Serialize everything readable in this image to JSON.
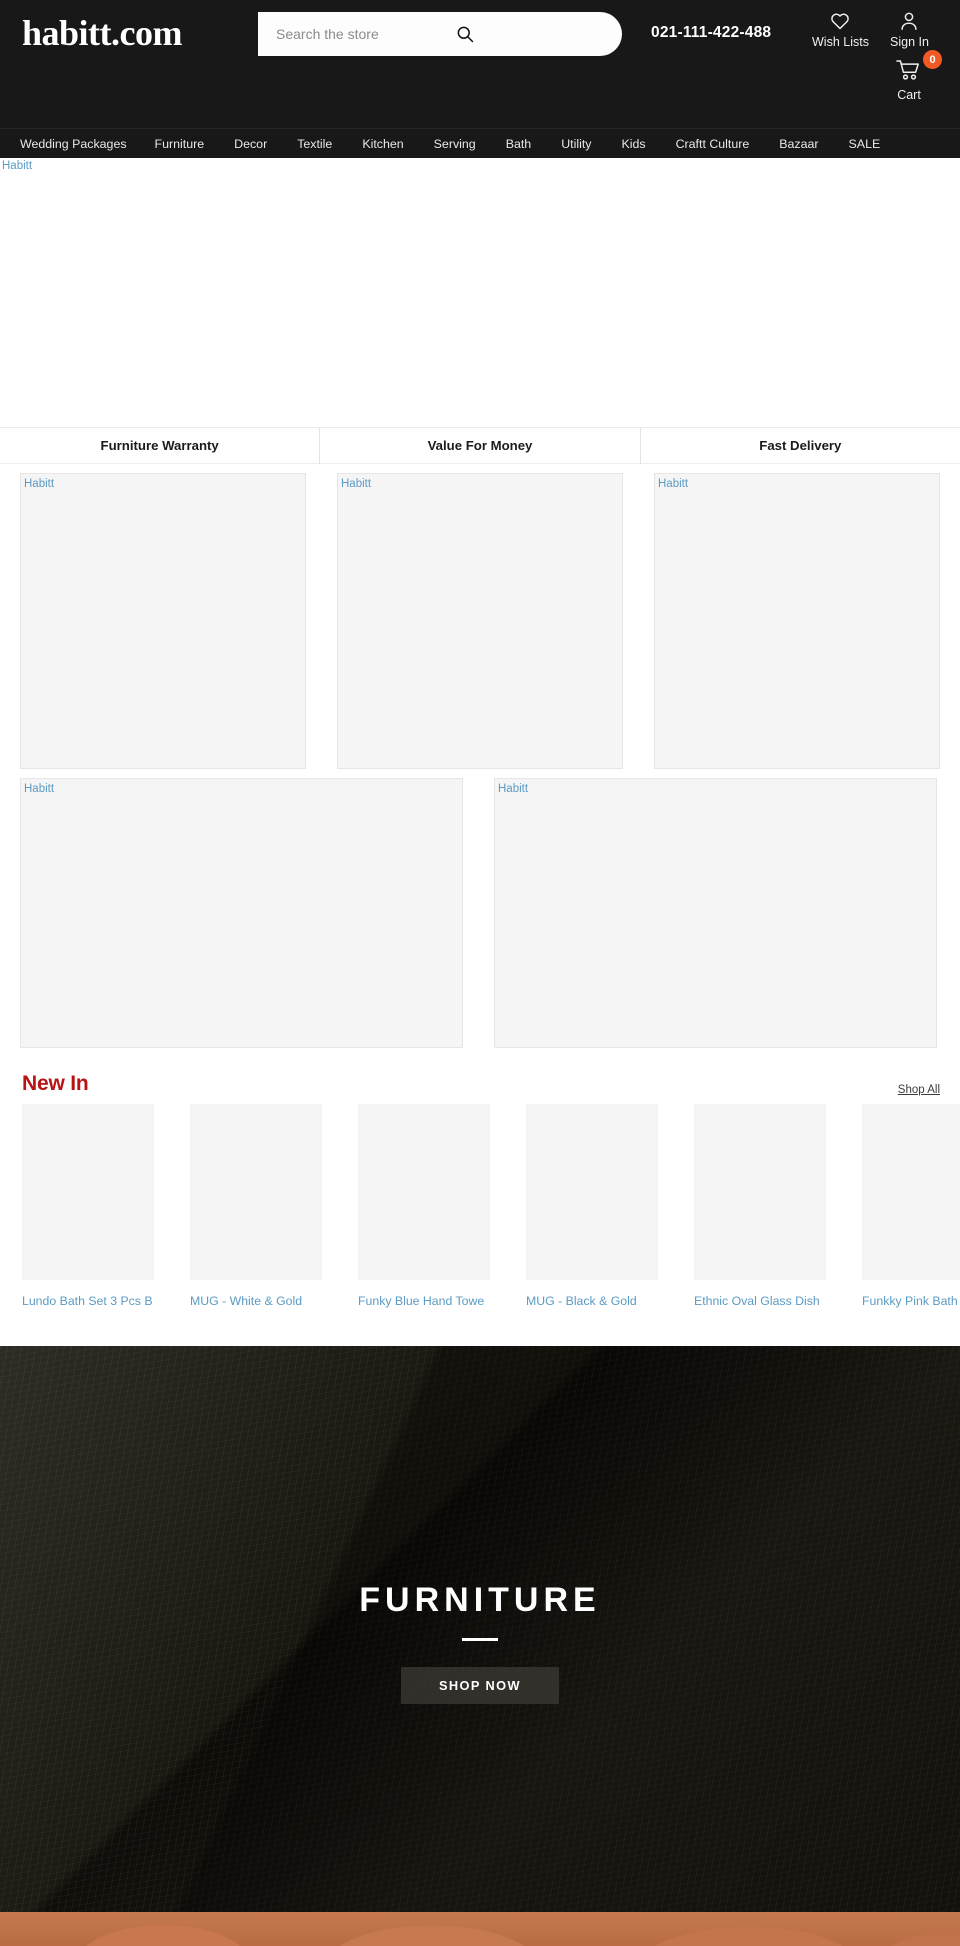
{
  "header": {
    "logo": "habitt.com",
    "search": {
      "placeholder": "Search the store",
      "value": ""
    },
    "phone": "021-111-422-488",
    "wishlist_label": "Wish Lists",
    "signin_label": "Sign In",
    "cart_label": "Cart",
    "cart_count": "0",
    "accent_orange": "#f15a24",
    "background": "#181818"
  },
  "nav": {
    "items": [
      {
        "label": "Wedding Packages"
      },
      {
        "label": "Furniture"
      },
      {
        "label": "Decor"
      },
      {
        "label": "Textile"
      },
      {
        "label": "Kitchen"
      },
      {
        "label": "Serving"
      },
      {
        "label": "Bath"
      },
      {
        "label": "Utility"
      },
      {
        "label": "Kids"
      },
      {
        "label": "Craftt Culture"
      },
      {
        "label": "Bazaar"
      },
      {
        "label": "SALE"
      }
    ]
  },
  "hero": {
    "alt": "Habitt"
  },
  "features": [
    {
      "label": "Furniture Warranty",
      "alt": "Habitt"
    },
    {
      "label": "Value For Money",
      "alt": "Habitt"
    },
    {
      "label": "Fast Delivery",
      "alt": "Habitt"
    }
  ],
  "promo_row": [
    {
      "alt": "Habitt"
    },
    {
      "alt": "Habitt"
    }
  ],
  "new_in": {
    "title": "New In",
    "title_color": "#b81414",
    "shop_all_label": "Shop All",
    "products": [
      {
        "name": "Lundo Bath Set 3 Pcs B"
      },
      {
        "name": "MUG - White & Gold"
      },
      {
        "name": "Funky Blue Hand Towe"
      },
      {
        "name": "MUG - Black & Gold"
      },
      {
        "name": "Ethnic Oval Glass Dish"
      },
      {
        "name": "Funkky Pink Bath Towe"
      }
    ]
  },
  "furniture_banner": {
    "title": "FURNITURE",
    "cta_label": "SHOP NOW"
  }
}
